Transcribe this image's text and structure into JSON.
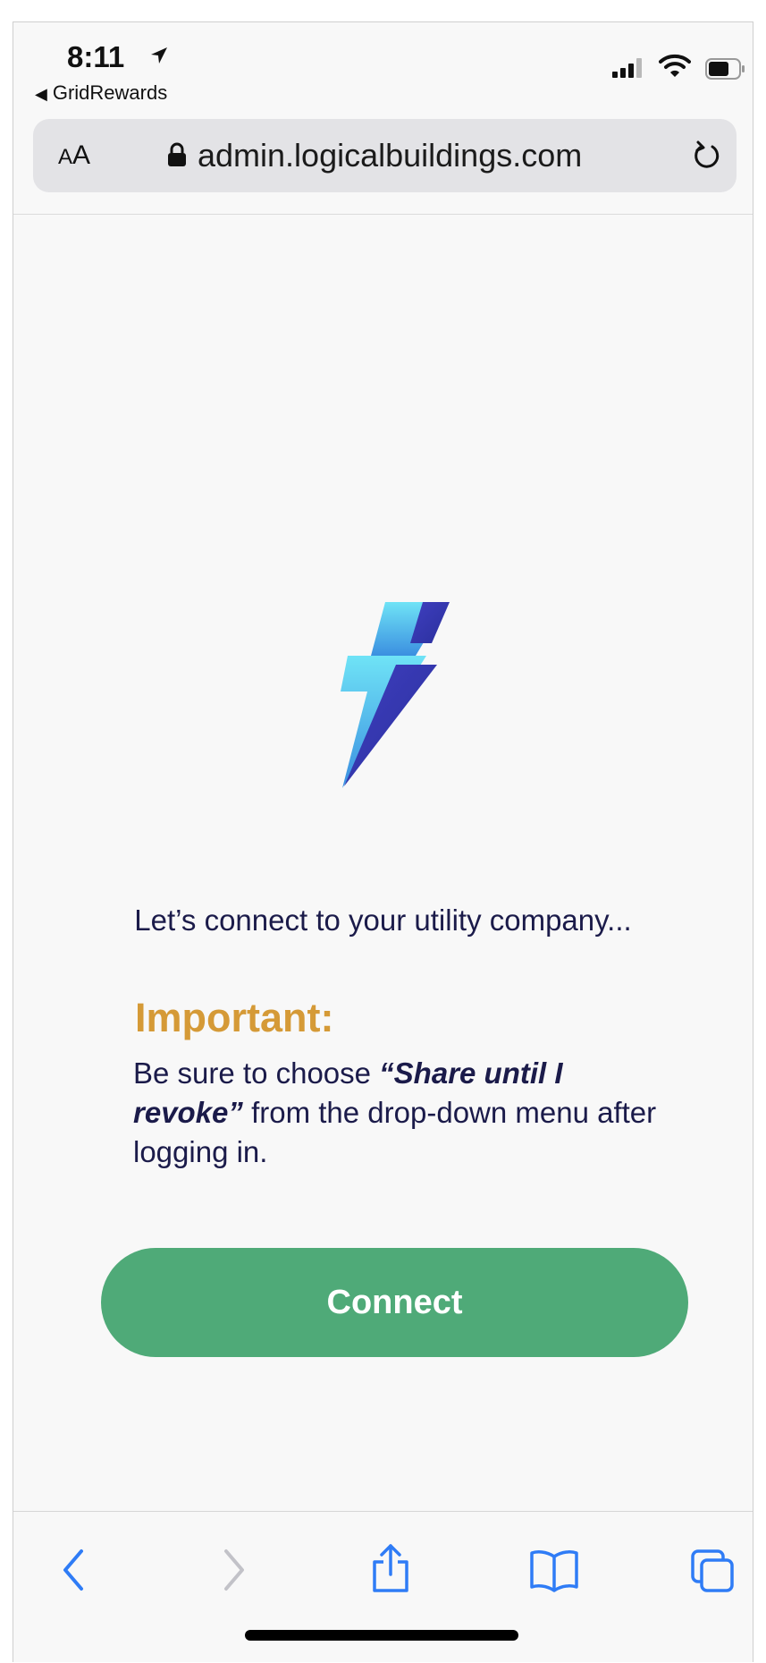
{
  "status_bar": {
    "time": "8:11",
    "back_app": "GridRewards"
  },
  "browser": {
    "text_size_label_small": "A",
    "text_size_label_large": "A",
    "url": "admin.logicalbuildings.com"
  },
  "page": {
    "headline": "Let’s connect to your utility company...",
    "important_title": "Important:",
    "important_pre": "Be sure to choose ",
    "important_emphasis": "“Share until I revoke”",
    "important_post": " from the drop-down menu after logging in.",
    "connect_label": "Connect"
  },
  "colors": {
    "accent_green": "#4faa78",
    "important_gold": "#d59a37",
    "text_navy": "#1b1b4a",
    "ios_blue": "#2f7cf6"
  },
  "toolbar": {
    "icons": [
      "back-icon",
      "forward-icon",
      "share-icon",
      "bookmarks-icon",
      "tabs-icon"
    ]
  }
}
